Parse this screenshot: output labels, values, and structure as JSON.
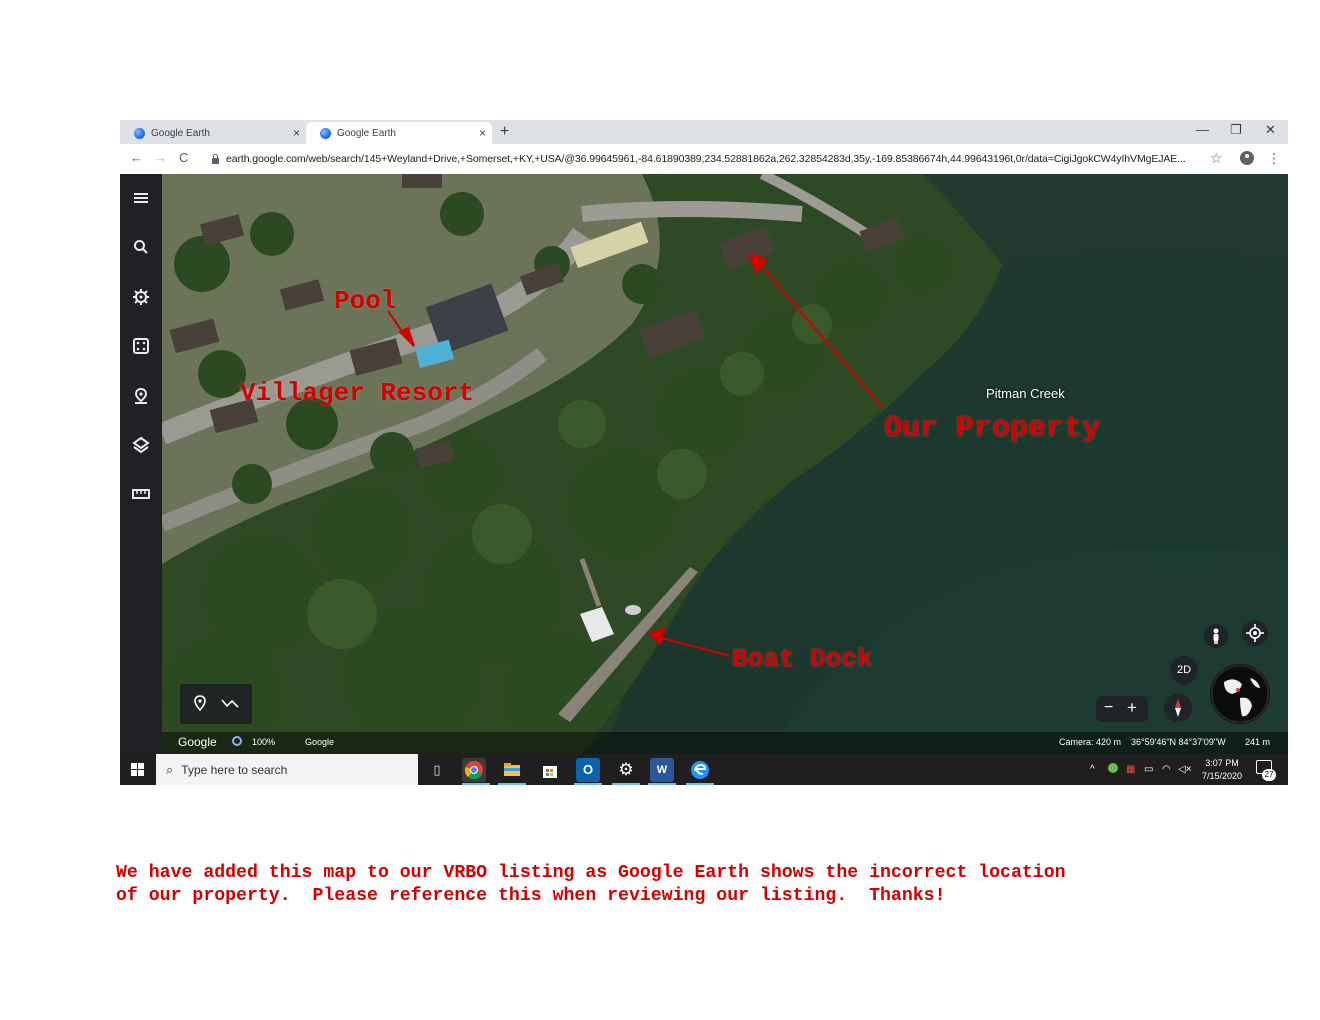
{
  "browser": {
    "tabs": [
      {
        "title": "Google Earth",
        "close": "×"
      },
      {
        "title": "Google Earth",
        "close": "×"
      }
    ],
    "new_tab": "+",
    "window_controls": {
      "minimize": "—",
      "restore": "❐",
      "close": "✕"
    },
    "nav": {
      "back": "←",
      "forward": "→",
      "reload": "C"
    },
    "url": "earth.google.com/web/search/145+Weyland+Drive,+Somerset,+KY,+USA/@36.99645961,-84.61890389,234.52881862a,262.32854283d,35y,-169.85386674h,44.99643196t,0r/data=CigiJgokCW4yIhVMgEJAE...",
    "star": "☆",
    "menu": "⋮"
  },
  "earth_sidebar": {
    "icons": [
      "menu-icon",
      "search-icon",
      "voyager-icon",
      "feeling-lucky-icon",
      "projects-icon",
      "map-style-icon",
      "measure-icon"
    ]
  },
  "map": {
    "place_label": "Pitman Creek",
    "annotations": {
      "pool": "Pool",
      "villager_resort": "Villager Resort",
      "our_property": "Our Property",
      "boat_dock": "Boat Dock"
    },
    "annotation_color": "#d40000",
    "controls": {
      "view_2d": "2D",
      "zoom_out": "−",
      "zoom_in": "+"
    }
  },
  "status_bar": {
    "logo": "Google",
    "load_percent": "100%",
    "attribution": "Google",
    "camera": "Camera: 420 m",
    "coordinates": "36°59'46\"N 84°37'09\"W",
    "scale": "241 m"
  },
  "taskbar": {
    "search_placeholder": "Type here to search",
    "apps": [
      "task-view-icon",
      "chrome-icon",
      "file-explorer-icon",
      "store-icon",
      "outlook-icon",
      "settings-icon",
      "word-icon",
      "edge-icon"
    ],
    "time": "3:07 PM",
    "date": "7/15/2020",
    "notifications": "27"
  },
  "caption": {
    "line1": "We have added this map to our VRBO listing as Google Earth shows the incorrect location",
    "line2": "of our property.  Please reference this when reviewing our listing.  Thanks!"
  }
}
